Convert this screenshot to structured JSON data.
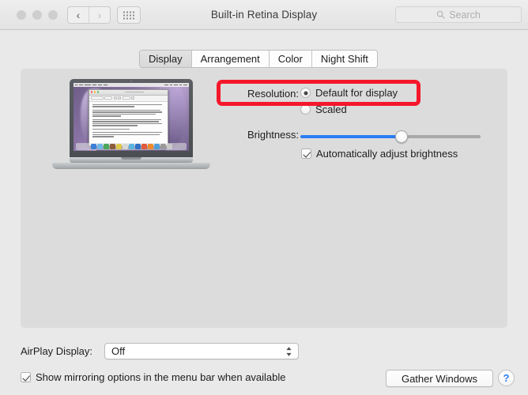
{
  "window": {
    "title": "Built-in Retina Display",
    "traffic_lights": [
      "close",
      "minimize",
      "zoom"
    ],
    "nav": {
      "back_icon": "chevron-left-icon",
      "forward_icon": "chevron-right-icon",
      "show_all_icon": "grid-dots-icon"
    },
    "search": {
      "placeholder": "Search",
      "icon": "search-icon",
      "value": ""
    }
  },
  "tabs": [
    {
      "label": "Display",
      "selected": true
    },
    {
      "label": "Arrangement",
      "selected": false
    },
    {
      "label": "Color",
      "selected": false
    },
    {
      "label": "Night Shift",
      "selected": false
    }
  ],
  "preview": {
    "device": "macbook-pro-illustration",
    "screen_content": "text-document-window-on-purple-wallpaper"
  },
  "resolution": {
    "label": "Resolution:",
    "options": [
      {
        "label": "Default for display",
        "selected": true
      },
      {
        "label": "Scaled",
        "selected": false
      }
    ]
  },
  "annotation": {
    "shape": "rectangle",
    "color": "#f5172b",
    "target": "resolution-default-for-display"
  },
  "brightness": {
    "label": "Brightness:",
    "value_percent": 56,
    "fill_color": "#2a7df4",
    "auto_adjust": {
      "label": "Automatically adjust brightness",
      "checked": true
    }
  },
  "airplay": {
    "label": "AirPlay Display:",
    "value": "Off",
    "options": [
      "Off"
    ],
    "arrows_icon": "chevron-up-down-icon"
  },
  "mirroring": {
    "label": "Show mirroring options in the menu bar when available",
    "checked": true
  },
  "footer": {
    "gather_windows_label": "Gather Windows",
    "help_label": "?"
  }
}
